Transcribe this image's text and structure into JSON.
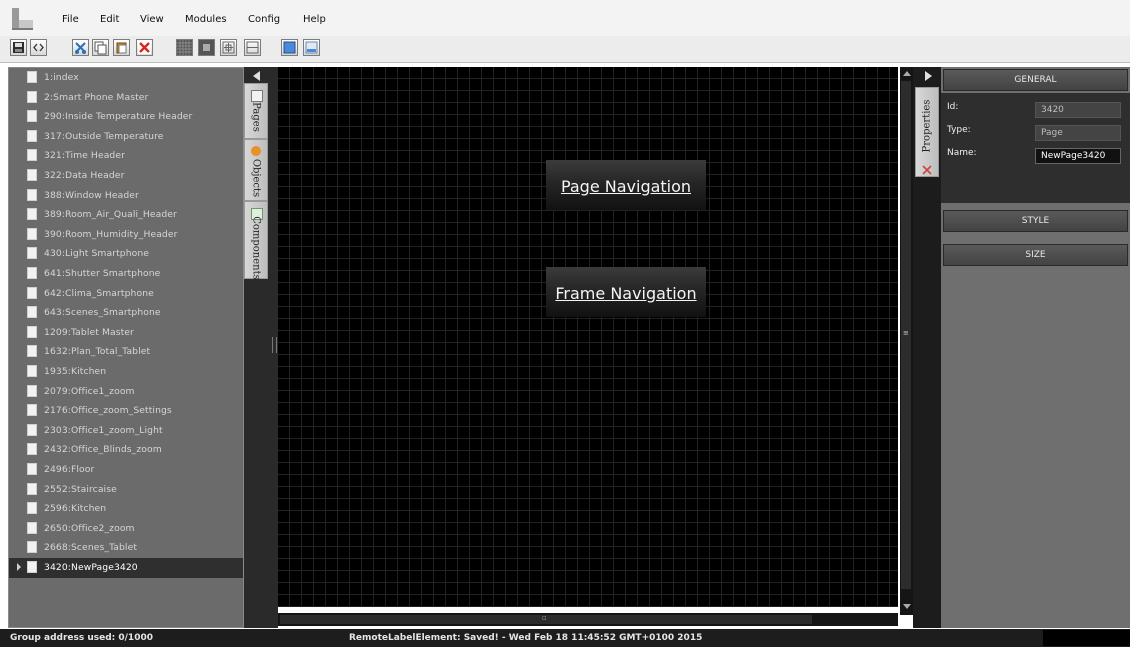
{
  "menu": {
    "items": [
      "File",
      "Edit",
      "View",
      "Modules",
      "Config",
      "Help"
    ]
  },
  "toolbar": {
    "icons": [
      "save-icon",
      "code-icon",
      "cut-icon",
      "copy-icon",
      "paste-icon",
      "delete-icon",
      "grid-dense-icon",
      "grid-medium-icon",
      "grid-crosshair-icon",
      "grid-small-icon",
      "window-normal-icon",
      "window-restore-icon"
    ]
  },
  "pages": {
    "items": [
      "1:index",
      "2:Smart Phone Master",
      "290:Inside Temperature Header",
      "317:Outside Temperature",
      "321:Time Header",
      "322:Data Header",
      "388:Window Header",
      "389:Room_Air_Quali_Header",
      "390:Room_Humidity_Header",
      "430:Light Smartphone",
      "641:Shutter Smartphone",
      "642:Clima_Smartphone",
      "643:Scenes_Smartphone",
      "1209:Tablet Master",
      "1632:Plan_Total_Tablet",
      "1935:Kitchen",
      "2079:Office1_zoom",
      "2176:Office_zoom_Settings",
      "2303:Office1_zoom_Light",
      "2432:Office_Blinds_zoom",
      "2496:Floor",
      "2552:Staircaise",
      "2596:Kitchen",
      "2650:Office2_zoom",
      "2668:Scenes_Tablet",
      "3420:NewPage3420"
    ],
    "selected_index": 25
  },
  "side_tabs": {
    "pages": "Pages",
    "objects": "Objects",
    "components": "Components",
    "properties": "Properties"
  },
  "canvas": {
    "page_nav_label": "Page Navigation",
    "frame_nav_label": "Frame Navigation"
  },
  "properties": {
    "general_title": "GENERAL",
    "id_label": "Id:",
    "id_value": "3420",
    "type_label": "Type:",
    "type_value": "Page",
    "name_label": "Name:",
    "name_value": "NewPage3420",
    "style_title": "STYLE",
    "size_title": "SIZE"
  },
  "status": {
    "group_address": "Group address used: 0/1000",
    "message": "RemoteLabelElement: Saved! - Wed Feb 18 11:45:52 GMT+0100 2015"
  },
  "colors": {
    "canvas_bg": "#000000",
    "grid_line": "#222222",
    "panel_gray": "#6b6b6b",
    "selected_row": "#2f2f2f"
  }
}
